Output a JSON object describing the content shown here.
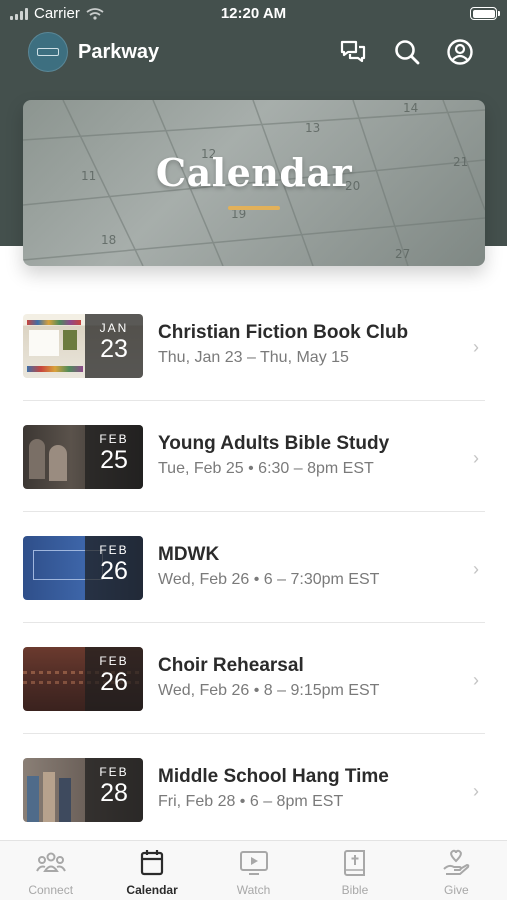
{
  "status_bar": {
    "carrier": "Carrier",
    "time": "12:20 AM"
  },
  "header": {
    "app_name": "Parkway"
  },
  "hero": {
    "title": "Calendar",
    "calendar_numbers": [
      "11",
      "12",
      "13",
      "14",
      "18",
      "19",
      "20",
      "21",
      "27"
    ],
    "accent_color": "#e2b15a"
  },
  "events": [
    {
      "title": "Christian Fiction Book Club",
      "subtitle": "Thu, Jan 23 – Thu, May 15",
      "month": "JAN",
      "day": "23"
    },
    {
      "title": "Young Adults Bible Study",
      "subtitle": "Tue, Feb 25 • 6:30 – 8pm EST",
      "month": "FEB",
      "day": "25"
    },
    {
      "title": "MDWK",
      "subtitle": "Wed, Feb 26 • 6 – 7:30pm EST",
      "month": "FEB",
      "day": "26"
    },
    {
      "title": "Choir Rehearsal",
      "subtitle": "Wed, Feb 26 • 8 – 9:15pm EST",
      "month": "FEB",
      "day": "26"
    },
    {
      "title": "Middle School Hang Time",
      "subtitle": "Fri, Feb 28 • 6 – 8pm EST",
      "month": "FEB",
      "day": "28"
    }
  ],
  "tabs": [
    {
      "label": "Connect",
      "icon": "people-icon"
    },
    {
      "label": "Calendar",
      "icon": "calendar-icon"
    },
    {
      "label": "Watch",
      "icon": "tv-icon"
    },
    {
      "label": "Bible",
      "icon": "bible-icon"
    },
    {
      "label": "Give",
      "icon": "give-icon"
    }
  ],
  "colors": {
    "header_bg": "#44504d",
    "active_tab": "#2b2b2b",
    "inactive_tab": "#a8a8a8"
  }
}
